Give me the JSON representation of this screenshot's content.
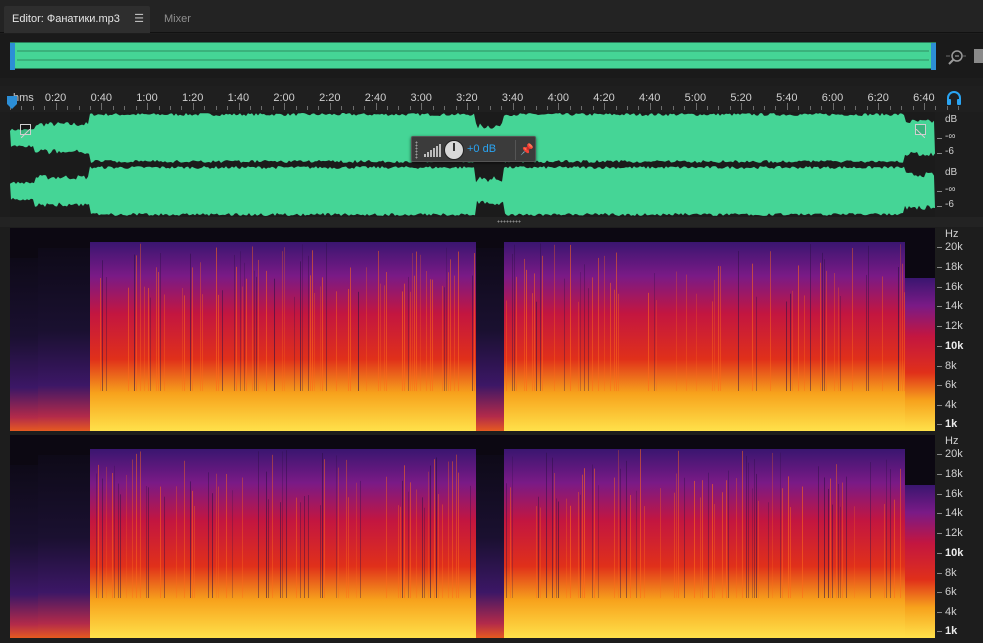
{
  "tabs": {
    "editor": "Editor: Фанатики.mp3",
    "mixer": "Mixer",
    "menu_icon": "menu-lines-icon"
  },
  "ruler": {
    "unit": "hms",
    "labels": [
      "0:20",
      "0:40",
      "1:00",
      "1:20",
      "1:40",
      "2:00",
      "2:20",
      "2:40",
      "3:00",
      "3:20",
      "3:40",
      "4:00",
      "4:20",
      "4:40",
      "5:00",
      "5:20",
      "5:40",
      "6:00",
      "6:20",
      "6:40"
    ]
  },
  "amplitude_hud": {
    "value": "+0 dB"
  },
  "db_scale": {
    "unit": "dB",
    "upper": "-∞",
    "lower": "-6"
  },
  "hz_scale": {
    "unit": "Hz",
    "labels": [
      "20k",
      "18k",
      "16k",
      "14k",
      "12k",
      "10k",
      "8k",
      "6k",
      "4k",
      "1k"
    ],
    "bold": [
      "10k",
      "1k"
    ]
  },
  "colors": {
    "waveform": "#45d596",
    "selection": "#2c8ed6",
    "hud_value": "#2aa4f2"
  },
  "icons": {
    "zoom": "zoom-icon",
    "headphones": "headphones-icon",
    "pin": "pin-icon",
    "level": "level-meter-icon"
  }
}
